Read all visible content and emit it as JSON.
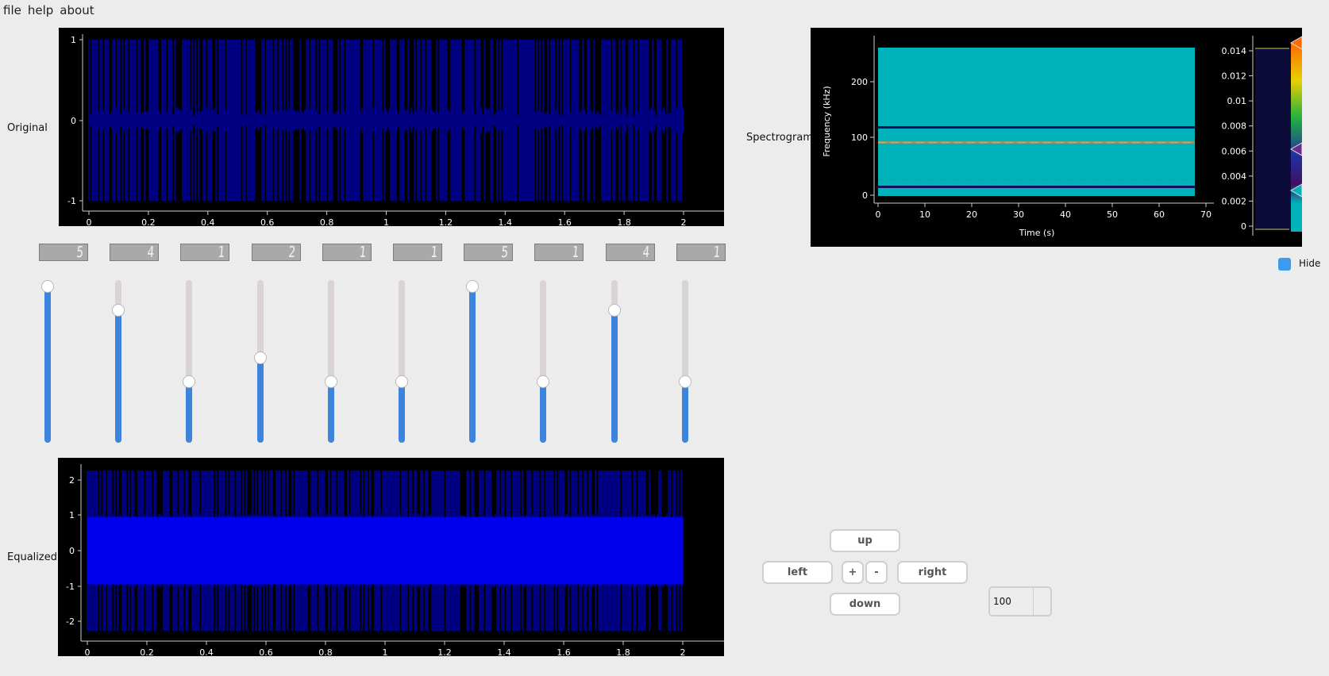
{
  "menu": [
    "file",
    "help",
    "about"
  ],
  "labels": {
    "original": "Original",
    "equalized": "Equalized",
    "spectrogram": "Spectrogram"
  },
  "original_plot": {
    "x_ticks": [
      "0",
      "0.2",
      "0.4",
      "0.6",
      "0.8",
      "1",
      "1.2",
      "1.4",
      "1.6",
      "1.8",
      "2"
    ],
    "y_ticks": [
      "1",
      "0",
      "-1"
    ],
    "trace_color": "#0000ff"
  },
  "equalized_plot": {
    "x_ticks": [
      "0",
      "0.2",
      "0.4",
      "0.6",
      "0.8",
      "1",
      "1.2",
      "1.4",
      "1.6",
      "1.8",
      "2"
    ],
    "y_ticks": [
      "2",
      "1",
      "0",
      "-1",
      "-2"
    ],
    "trace_color": "#0000ff"
  },
  "equalizer": {
    "max": 5,
    "bands": [
      {
        "display": "5",
        "value": 5
      },
      {
        "display": "4",
        "value": 4
      },
      {
        "display": "1",
        "value": 1
      },
      {
        "display": "2",
        "value": 2
      },
      {
        "display": "1",
        "value": 1
      },
      {
        "display": "1",
        "value": 1
      },
      {
        "display": "5",
        "value": 5
      },
      {
        "display": "1",
        "value": 1
      },
      {
        "display": "4",
        "value": 4
      },
      {
        "display": "1",
        "value": 1
      }
    ],
    "accent_color": "#3d84dd"
  },
  "spectrogram": {
    "xlabel": "Time (s)",
    "ylabel": "Frequency (kHz)",
    "x_ticks": [
      "0",
      "10",
      "20",
      "30",
      "40",
      "50",
      "60",
      "70"
    ],
    "y_ticks": [
      "200",
      "100",
      "0"
    ],
    "colorbar_ticks": [
      "0.014",
      "0.012",
      "0.01",
      "0.008",
      "0.006",
      "0.004",
      "0.002",
      "0"
    ],
    "background_color": "#00b3bb",
    "band_color": "#101060"
  },
  "hide_checkbox": {
    "label": "Hide",
    "checked": true
  },
  "controls": {
    "up": "up",
    "left": "left",
    "plus": "+",
    "minus": "-",
    "right": "right",
    "down": "down"
  },
  "spinbox": {
    "value": "100"
  }
}
